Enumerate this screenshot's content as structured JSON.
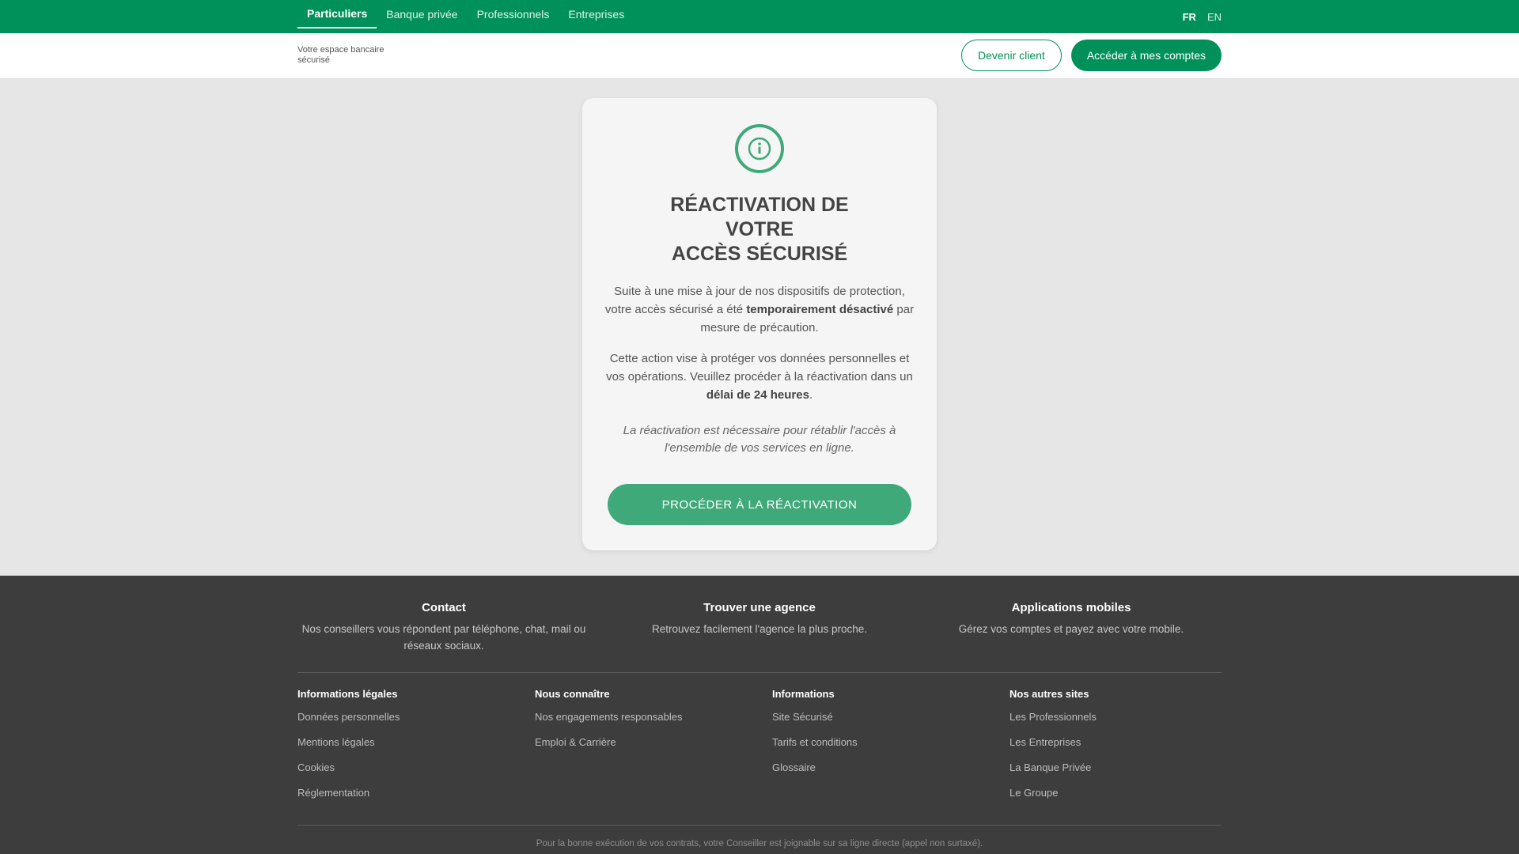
{
  "topnav": {
    "tabs": [
      {
        "label": "Particuliers",
        "active": true
      },
      {
        "label": "Banque privée",
        "active": false
      },
      {
        "label": "Professionnels",
        "active": false
      },
      {
        "label": "Entreprises",
        "active": false
      }
    ],
    "langs": [
      {
        "label": "FR",
        "active": true
      },
      {
        "label": "EN",
        "active": false
      }
    ]
  },
  "header": {
    "tagline": "Votre espace bancaire sécurisé",
    "become_client": "Devenir client",
    "access_accounts": "Accéder à mes comptes"
  },
  "card": {
    "icon": "info-icon",
    "title_lines": [
      "RÉACTIVATION DE",
      "VOTRE",
      "ACCÈS SÉCURISÉ"
    ],
    "p1_pre": "Suite à une mise à jour de nos dispositifs de protection, votre accès sécurisé a été ",
    "p1_bold": "temporairement désactivé",
    "p1_post": " par mesure de précaution.",
    "p2_pre": "Cette action vise à protéger vos données personnelles et vos opérations. Veuillez procéder à la réactivation dans un ",
    "p2_bold": "délai de 24 heures",
    "p2_post": ".",
    "p3": "La réactivation est nécessaire pour rétablir l'accès à l'ensemble de vos services en ligne.",
    "cta": "PROCÉDER À LA RÉACTIVATION"
  },
  "footer": {
    "services": [
      {
        "title": "Contact",
        "text": "Nos conseillers vous répondent par téléphone, chat, mail ou réseaux sociaux."
      },
      {
        "title": "Trouver une agence",
        "text": "Retrouvez facilement l'agence la plus proche."
      },
      {
        "title": "Applications mobiles",
        "text": "Gérez vos comptes et payez avec votre mobile."
      }
    ],
    "columns": [
      {
        "title": "Informations légales",
        "links": [
          "Données personnelles",
          "Mentions légales",
          "Cookies",
          "Réglementation"
        ]
      },
      {
        "title": "Nous connaître",
        "links": [
          "Nos engagements responsables",
          "Emploi & Carrière"
        ]
      },
      {
        "title": "Informations",
        "links": [
          "Site Sécurisé",
          "Tarifs et conditions",
          "Glossaire"
        ]
      },
      {
        "title": "Nos autres sites",
        "links": [
          "Les Professionnels",
          "Les Entreprises",
          "La Banque Privée",
          "Le Groupe"
        ]
      }
    ],
    "legal": "Pour la bonne exécution de vos contrats, votre Conseiller est joignable sur sa ligne directe (appel non surtaxé)."
  },
  "colors": {
    "brand": "#00915a",
    "cta": "#3fa97a",
    "footer_bg": "#3d3d3d"
  }
}
